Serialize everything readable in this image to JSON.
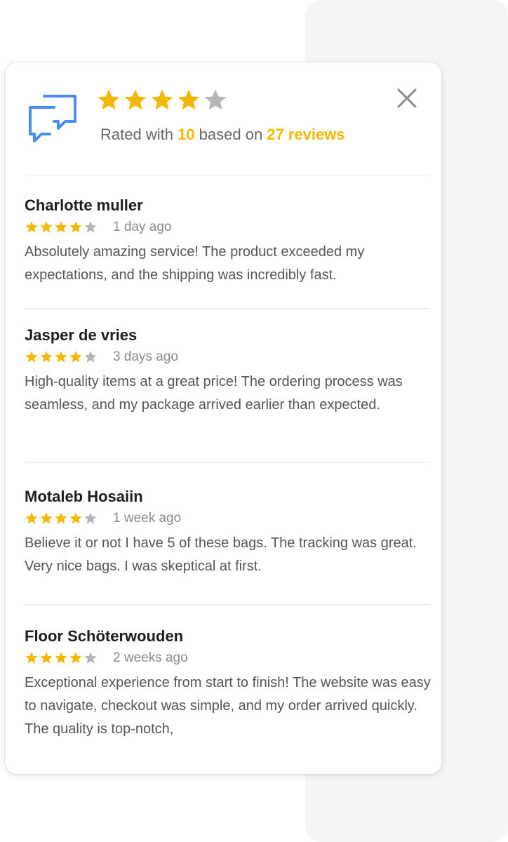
{
  "header": {
    "rating_value": 4,
    "rating_max": 5,
    "rated_prefix": "Rated with ",
    "rated_score": "10",
    "rated_middle": " based on ",
    "rated_reviews": "27 reviews"
  },
  "colors": {
    "star_filled": "#f5b800",
    "star_empty": "#b5b5b5",
    "icon_blue": "#4a8df0",
    "close_gray": "#8a8a8a"
  },
  "icons": {
    "header_icon": "chat-bubbles-icon",
    "close": "close-icon",
    "star": "star-icon"
  },
  "reviews": [
    {
      "name": "Charlotte muller",
      "rating": 4,
      "time": "1 day ago",
      "text": "Absolutely amazing service! The product exceeded my expectations, and the shipping was incredibly fast."
    },
    {
      "name": "Jasper de vries",
      "rating": 4,
      "time": "3 days ago",
      "text": "High-quality items at a great price! The ordering process was seamless, and my package arrived earlier than expected."
    },
    {
      "name": "Motaleb Hosaiin",
      "rating": 4,
      "time": "1 week ago",
      "text": "Believe it or not I have 5 of these bags. The tracking was great. Very nice bags. I was skeptical at first."
    },
    {
      "name": "Floor Schöterwouden",
      "rating": 4,
      "time": "2 weeks ago",
      "text": "Exceptional experience from start to finish! The website was easy to navigate, checkout was simple, and my order arrived quickly. The quality is top-notch,"
    }
  ]
}
